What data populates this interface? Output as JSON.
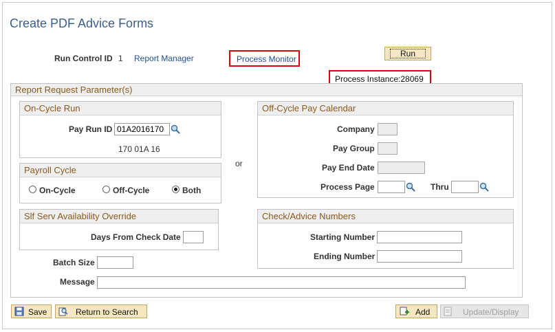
{
  "page": {
    "title": "Create PDF Advice Forms"
  },
  "header": {
    "run_control_label": "Run Control ID",
    "run_control_value": "1",
    "report_manager": "Report Manager",
    "process_monitor": "Process Monitor",
    "run_label": "Run",
    "process_instance": "Process Instance:28069"
  },
  "report_params": {
    "title": "Report Request Parameter(s)"
  },
  "on_cycle": {
    "title": "On-Cycle Run",
    "pay_run_label": "Pay Run ID",
    "pay_run_value": "01A2016170",
    "description": "170 01A 16"
  },
  "or_text": "or",
  "payroll_cycle": {
    "title": "Payroll Cycle",
    "options": [
      {
        "label": "On-Cycle",
        "selected": false
      },
      {
        "label": "Off-Cycle",
        "selected": false
      },
      {
        "label": "Both",
        "selected": true
      }
    ]
  },
  "off_cycle": {
    "title": "Off-Cycle Pay Calendar",
    "company_label": "Company",
    "company_value": "",
    "pay_group_label": "Pay Group",
    "pay_group_value": "",
    "pay_end_date_label": "Pay End Date",
    "pay_end_date_value": "",
    "process_page_label": "Process Page",
    "process_page_value": "",
    "thru_label": "Thru",
    "thru_value": ""
  },
  "self_serv": {
    "title": "Slf Serv Availability Override",
    "days_label": "Days From Check Date",
    "days_value": ""
  },
  "check_advice": {
    "title": "Check/Advice Numbers",
    "starting_label": "Starting Number",
    "starting_value": "",
    "ending_label": "Ending Number",
    "ending_value": ""
  },
  "batch": {
    "label": "Batch Size",
    "value": ""
  },
  "message": {
    "label": "Message",
    "value": ""
  },
  "toolbar": {
    "save": "Save",
    "return_to_search": "Return to Search",
    "add": "Add",
    "update_display": "Update/Display"
  },
  "colors": {
    "accent_title": "#3b5f8a",
    "group_title": "#8a5a1e",
    "highlight": "#d8000c",
    "button_bg": "#f5e7c3"
  }
}
